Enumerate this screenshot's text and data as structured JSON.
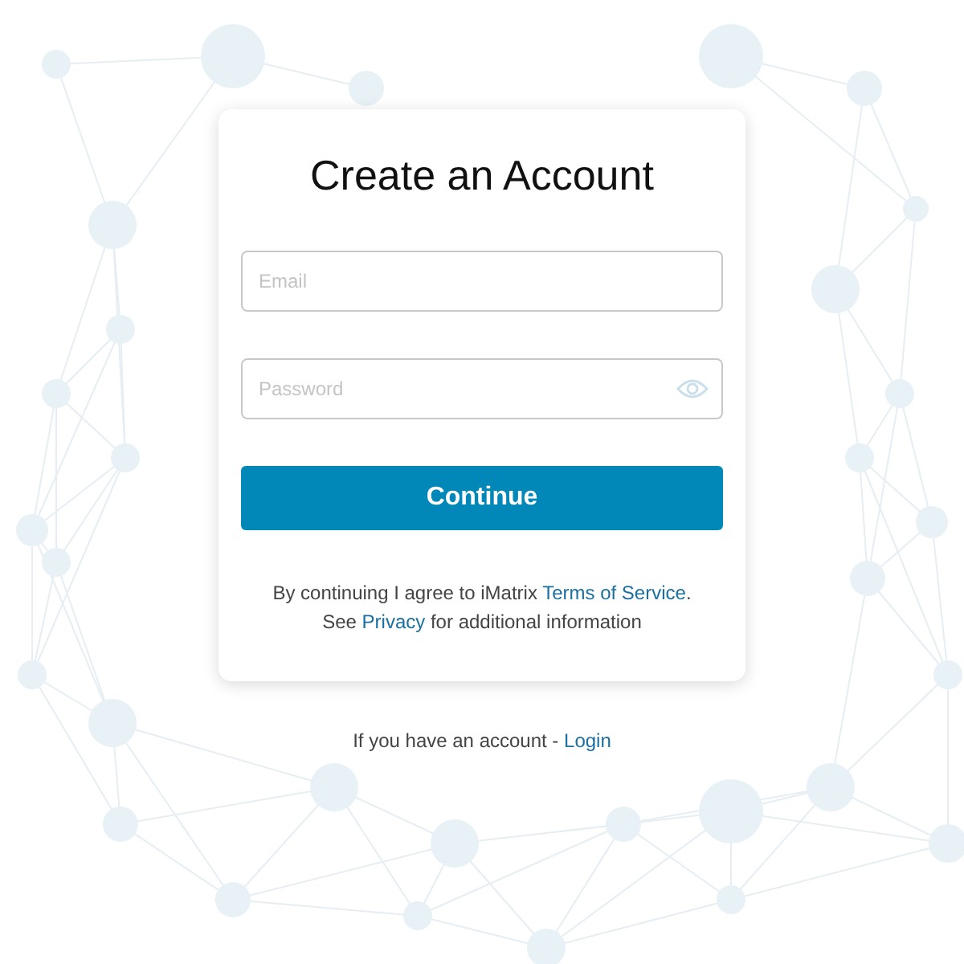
{
  "title": "Create an Account",
  "fields": [
    {
      "placeholder": "Email",
      "kind": "text"
    },
    {
      "placeholder": "Password",
      "kind": "password"
    }
  ],
  "submit": "Continue",
  "agreement": [
    {
      "before": "By continuing I agree to iMatrix ",
      "link": "Terms of Service",
      "after": "."
    },
    {
      "before": "See ",
      "link": "Privacy",
      "after": " for additional information"
    }
  ],
  "footer": {
    "text": "If you have an account - ",
    "link": "Login"
  }
}
